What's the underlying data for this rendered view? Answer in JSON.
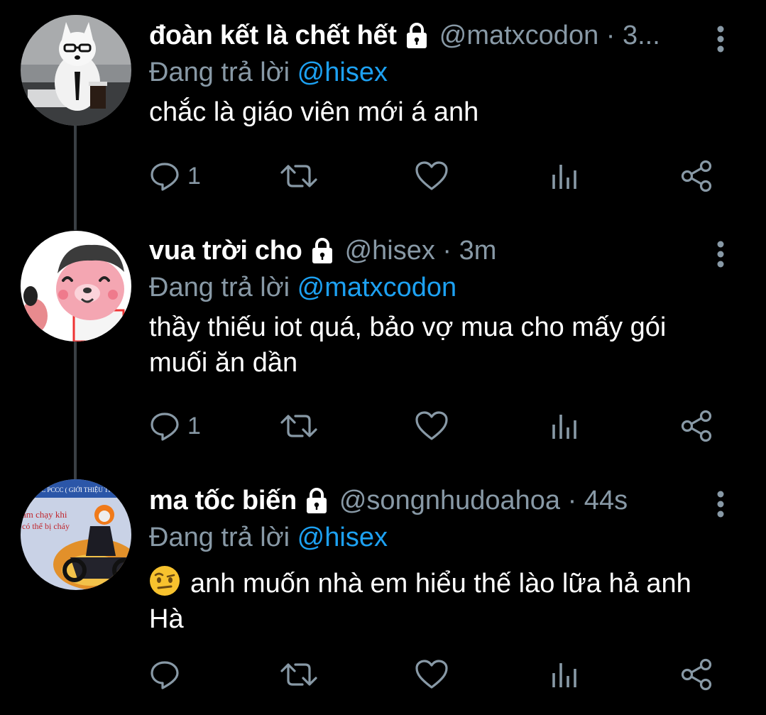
{
  "tweets": [
    {
      "display_name": "đoàn kết là chết hết",
      "handle": "@matxcodon · 3...",
      "replying_prefix": "Đang trả lời",
      "replying_to": "@hisex",
      "text": "chắc là giáo viên mới á anh",
      "emoji": "",
      "reply_count": "1",
      "avatar": "dog-in-office-avatar"
    },
    {
      "display_name": "vua trời cho",
      "handle": "@hisex · 3m",
      "replying_prefix": "Đang trả lời",
      "replying_to": "@matxcodon",
      "text": "thầy thiếu iot quá, bảo vợ mua cho mấy gói muối ăn dần",
      "emoji": "",
      "reply_count": "1",
      "avatar": "cartoon-bear-avatar"
    },
    {
      "display_name": "ma tốc biến",
      "handle": "@songnhudoahoa · 44s",
      "replying_prefix": "Đang trả lời",
      "replying_to": "@hisex",
      "text": "anh muốn nhà em hiểu thế lào lữa hả anh Hà",
      "emoji": "face-with-raised-eyebrow",
      "reply_count": "",
      "avatar": "ghost-rider-poster-avatar",
      "avatar_text": {
        "banner": "NG TÁC PCCC ( GIỚI THIỆU THI",
        "line1": "ẩm chạy khi",
        "line2": "có thể bị cháy"
      }
    }
  ],
  "icons": {
    "lock": "lock-icon",
    "more": "more-vertical-icon",
    "reply": "reply-icon",
    "retweet": "retweet-icon",
    "like": "heart-icon",
    "analytics": "analytics-icon",
    "share": "share-icon"
  },
  "colors": {
    "background": "#000000",
    "text": "#ffffff",
    "secondary": "#8899a6",
    "mention": "#1da1f2",
    "thread_line": "#3a3f44"
  }
}
